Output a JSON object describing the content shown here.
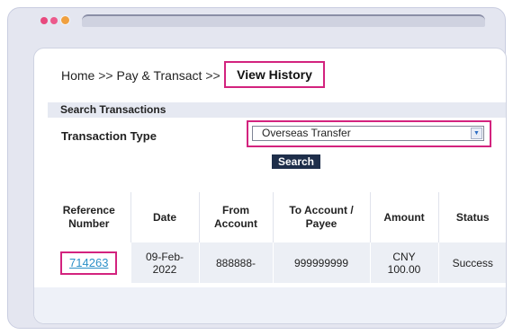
{
  "breadcrumb": {
    "home": "Home",
    "separator": ">>",
    "pay": "Pay & Transact",
    "current": "View History"
  },
  "search": {
    "section_title": "Search Transactions",
    "type_label": "Transaction Type",
    "type_value": "Overseas Transfer",
    "button_label": "Search"
  },
  "table": {
    "headers": [
      "Reference Number",
      "Date",
      "From Account",
      "To Account / Payee",
      "Amount",
      "Status"
    ],
    "rows": [
      {
        "reference": "714263",
        "date": "09-Feb-2022",
        "from_account": "888888-",
        "to_account": "999999999",
        "amount": "CNY 100.00",
        "status": "Success"
      }
    ]
  },
  "colors": {
    "highlight": "#d3237e",
    "button": "#1e2e4a",
    "link": "#2a8fc8"
  }
}
